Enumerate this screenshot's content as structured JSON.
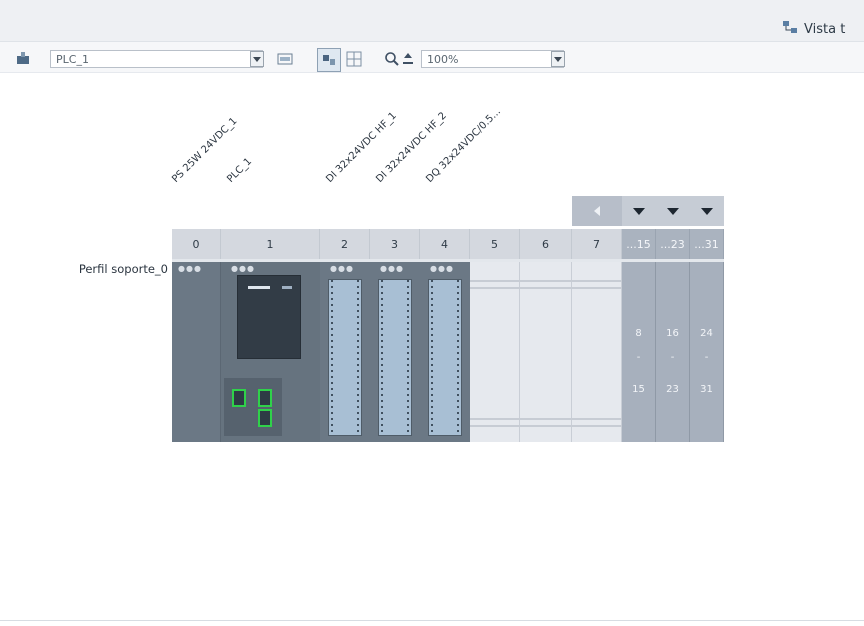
{
  "header": {
    "view_button_label": "Vista t"
  },
  "toolbar": {
    "device_select": "PLC_1",
    "zoom_value": "100%"
  },
  "modules": {
    "labels": [
      "PS 25W 24VDC_1",
      "PLC_1",
      "DI 32x24VDC HF_1",
      "DI 32x24VDC HF_2",
      "DQ 32x24VDC/0.5..."
    ]
  },
  "rack": {
    "name": "Perfil soporte_0",
    "slots": [
      "0",
      "1",
      "2",
      "3",
      "4",
      "5",
      "6",
      "7",
      "...15",
      "...23",
      "...31"
    ],
    "expansion": [
      {
        "from": "8",
        "dash": "-",
        "to": "15"
      },
      {
        "from": "16",
        "dash": "-",
        "to": "23"
      },
      {
        "from": "24",
        "dash": "-",
        "to": "31"
      }
    ]
  },
  "icons": [
    "device-view-icon",
    "pair-icon",
    "network-icon",
    "grid-icon",
    "zoom-icon",
    "zoom-slider-icon"
  ]
}
